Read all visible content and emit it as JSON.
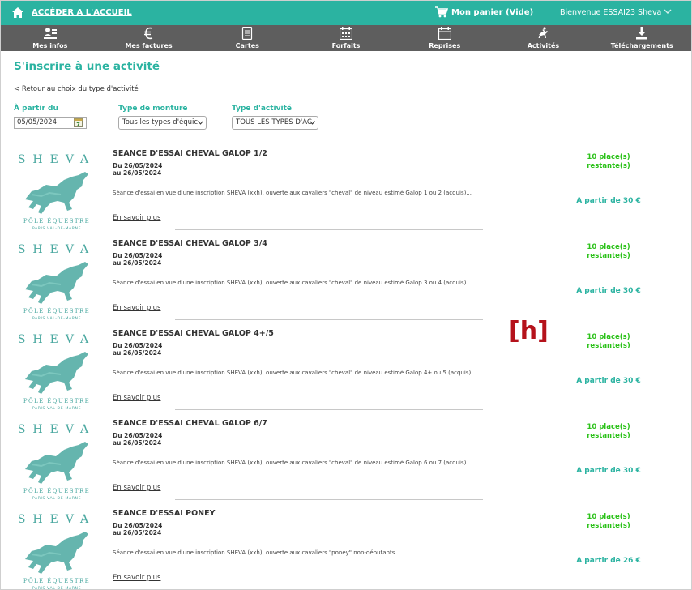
{
  "topbar": {
    "home_label": "ACCÉDER A L'ACCUEIL",
    "cart_label": "Mon panier (Vide)",
    "welcome": "Bienvenue ESSAI23 Sheva"
  },
  "nav": [
    {
      "label": "Mes infos",
      "icon": "user-icon"
    },
    {
      "label": "Mes factures",
      "icon": "euro-icon"
    },
    {
      "label": "Cartes",
      "icon": "card-icon"
    },
    {
      "label": "Forfaits",
      "icon": "calendar-grid-icon"
    },
    {
      "label": "Reprises",
      "icon": "calendar-icon"
    },
    {
      "label": "Activités",
      "icon": "rider-icon"
    },
    {
      "label": "Téléchargements",
      "icon": "download-icon"
    }
  ],
  "page": {
    "title": "S'inscrire à une activité",
    "back_link": "< Retour au choix du type d'activité"
  },
  "filters": {
    "date_label": "À partir du",
    "date_value": "05/05/2024",
    "mount_label": "Type de monture",
    "mount_value": "Tous les types d'équic",
    "activity_label": "Type d'activité",
    "activity_value": "TOUS LES TYPES D'AC"
  },
  "logo": {
    "top": "SHEVA",
    "line1": "PÔLE ÉQUESTRE",
    "line2": "PARIS VAL-DE-MARNE"
  },
  "activities": [
    {
      "title": "SEANCE D'ESSAI CHEVAL GALOP 1/2",
      "date_from": "Du 26/05/2024",
      "date_to": "au 26/05/2024",
      "description": "Séance d'essai en vue d'une inscription SHEVA (xxh), ouverte aux cavaliers \"cheval\" de niveau estimé Galop 1 ou 2 (acquis)...",
      "more": "En savoir plus",
      "places_1": "10 place(s)",
      "places_2": "restante(s)",
      "price": "A partir de 30 €"
    },
    {
      "title": "SEANCE D'ESSAI CHEVAL GALOP 3/4",
      "date_from": "Du 26/05/2024",
      "date_to": "au 26/05/2024",
      "description": "Séance d'essai en vue d'une inscription SHEVA (xxh), ouverte aux cavaliers \"cheval\" de niveau estimé Galop 3 ou 4 (acquis)...",
      "more": "En savoir plus",
      "places_1": "10 place(s)",
      "places_2": "restante(s)",
      "price": "A partir de 30 €"
    },
    {
      "title": "SEANCE D'ESSAI CHEVAL GALOP 4+/5",
      "date_from": "Du 26/05/2024",
      "date_to": "au 26/05/2024",
      "description": "Séance d'essai en vue d'une inscription SHEVA (xxh), ouverte aux cavaliers \"cheval\" de niveau estimé Galop 4+ ou 5 (acquis)...",
      "more": "En savoir plus",
      "places_1": "10 place(s)",
      "places_2": "restante(s)",
      "price": "A partir de 30 €"
    },
    {
      "title": "SEANCE D'ESSAI CHEVAL GALOP 6/7",
      "date_from": "Du 26/05/2024",
      "date_to": "au 26/05/2024",
      "description": "Séance d'essai en vue d'une inscription SHEVA (xxh), ouverte aux cavaliers \"cheval\" de niveau estimé Galop 6 ou 7 (acquis)...",
      "more": "En savoir plus",
      "places_1": "10 place(s)",
      "places_2": "restante(s)",
      "price": "A partir de 30 €"
    },
    {
      "title": "SEANCE D'ESSAI PONEY",
      "date_from": "Du 26/05/2024",
      "date_to": "au 26/05/2024",
      "description": "Séance d'essai en vue d'une inscription SHEVA (xxh), ouverte aux cavaliers \"poney\" non-débutants...",
      "more": "En savoir plus",
      "places_1": "10 place(s)",
      "places_2": "restante(s)",
      "price": "A partir de 26 €"
    }
  ],
  "annotation": "[h]",
  "colors": {
    "accent": "#2bb3a1",
    "nav_bg": "#5e5e5e",
    "places_green": "#2cc21a",
    "annotation_red": "#b5121b"
  }
}
